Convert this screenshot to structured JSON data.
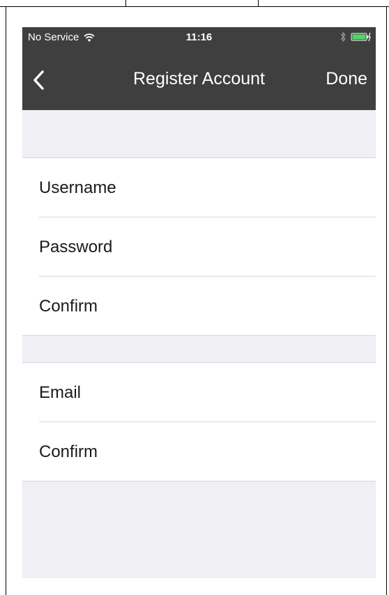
{
  "status_bar": {
    "carrier": "No Service",
    "time": "11:16",
    "wifi_icon": "wifi-icon",
    "bluetooth_icon": "bluetooth-icon",
    "battery_icon": "battery-charging-icon",
    "battery_color": "#4cd964"
  },
  "nav_bar": {
    "back_icon": "chevron-left-icon",
    "title": "Register Account",
    "done_label": "Done",
    "background": "#3f3f3f"
  },
  "form": {
    "account_group": [
      {
        "label": "Username",
        "value": ""
      },
      {
        "label": "Password",
        "value": ""
      },
      {
        "label": "Confirm",
        "value": ""
      }
    ],
    "email_group": [
      {
        "label": "Email",
        "value": ""
      },
      {
        "label": "Confirm",
        "value": ""
      }
    ]
  }
}
